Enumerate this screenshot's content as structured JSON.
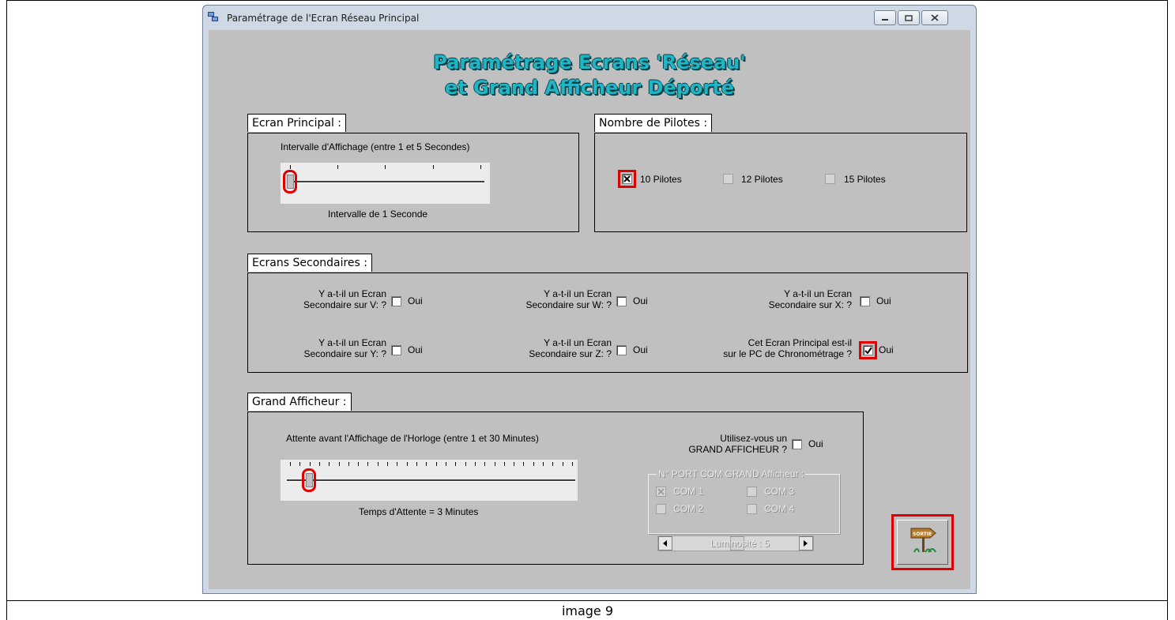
{
  "window": {
    "title": "Paramétrage de l'Ecran Réseau Principal",
    "buttons": {
      "minimize": "minimize-icon",
      "maximize": "maximize-icon",
      "close": "close-icon"
    }
  },
  "heading": {
    "line1": "Paramétrage Ecrans 'Réseau'",
    "line2": "et Grand Afficheur Déporté"
  },
  "ecran_principal": {
    "title": "Ecran Principal :",
    "interval_label": "Intervalle d'Affichage  (entre 1 et 5 Secondes)",
    "interval_value": 1,
    "interval_range": [
      1,
      5
    ],
    "interval_status": "Intervalle de 1 Seconde"
  },
  "pilotes": {
    "title": "Nombre de Pilotes :",
    "options": [
      {
        "label": "10 Pilotes",
        "checked": true
      },
      {
        "label": "12 Pilotes",
        "checked": false
      },
      {
        "label": "15 Pilotes",
        "checked": false
      }
    ]
  },
  "secondaires": {
    "title": "Ecrans Secondaires :",
    "items": [
      {
        "line1": "Y a-t-il un Ecran",
        "line2": "Secondaire sur V: ?",
        "option": "Oui",
        "checked": false
      },
      {
        "line1": "Y a-t-il un Ecran",
        "line2": "Secondaire sur W: ?",
        "option": "Oui",
        "checked": false
      },
      {
        "line1": "Y a-t-il un Ecran",
        "line2": "Secondaire sur X: ?",
        "option": "Oui",
        "checked": false
      },
      {
        "line1": "Y a-t-il un Ecran",
        "line2": "Secondaire sur Y: ?",
        "option": "Oui",
        "checked": false
      },
      {
        "line1": "Y a-t-il un Ecran",
        "line2": "Secondaire sur Z: ?",
        "option": "Oui",
        "checked": false
      },
      {
        "line1": "Cet Ecran Principal est-il",
        "line2": "sur le PC de Chronométrage ?",
        "option": "Oui",
        "checked": true
      }
    ]
  },
  "grand_afficheur": {
    "title": "Grand Afficheur :",
    "wait_label": "Attente avant l'Affichage de l'Horloge (entre 1 et 30 Minutes)",
    "wait_value": 3,
    "wait_range": [
      1,
      30
    ],
    "wait_status": "Temps d'Attente = 3 Minutes",
    "use_line1": "Utilisez-vous un",
    "use_line2": "GRAND AFFICHEUR ?",
    "use_option": "Oui",
    "use_checked": false,
    "port_title": "N° PORT COM GRAND Afficheur :",
    "ports": [
      {
        "label": "COM 1",
        "checked": true
      },
      {
        "label": "COM 3",
        "checked": false
      },
      {
        "label": "COM 2",
        "checked": false
      },
      {
        "label": "COM 4",
        "checked": false
      }
    ],
    "brightness_label": "Luminosité : 5",
    "brightness_value": 5
  },
  "exit_button": {
    "label": "SORTIE",
    "icon": "exit-signpost-icon"
  },
  "caption": "image 9"
}
